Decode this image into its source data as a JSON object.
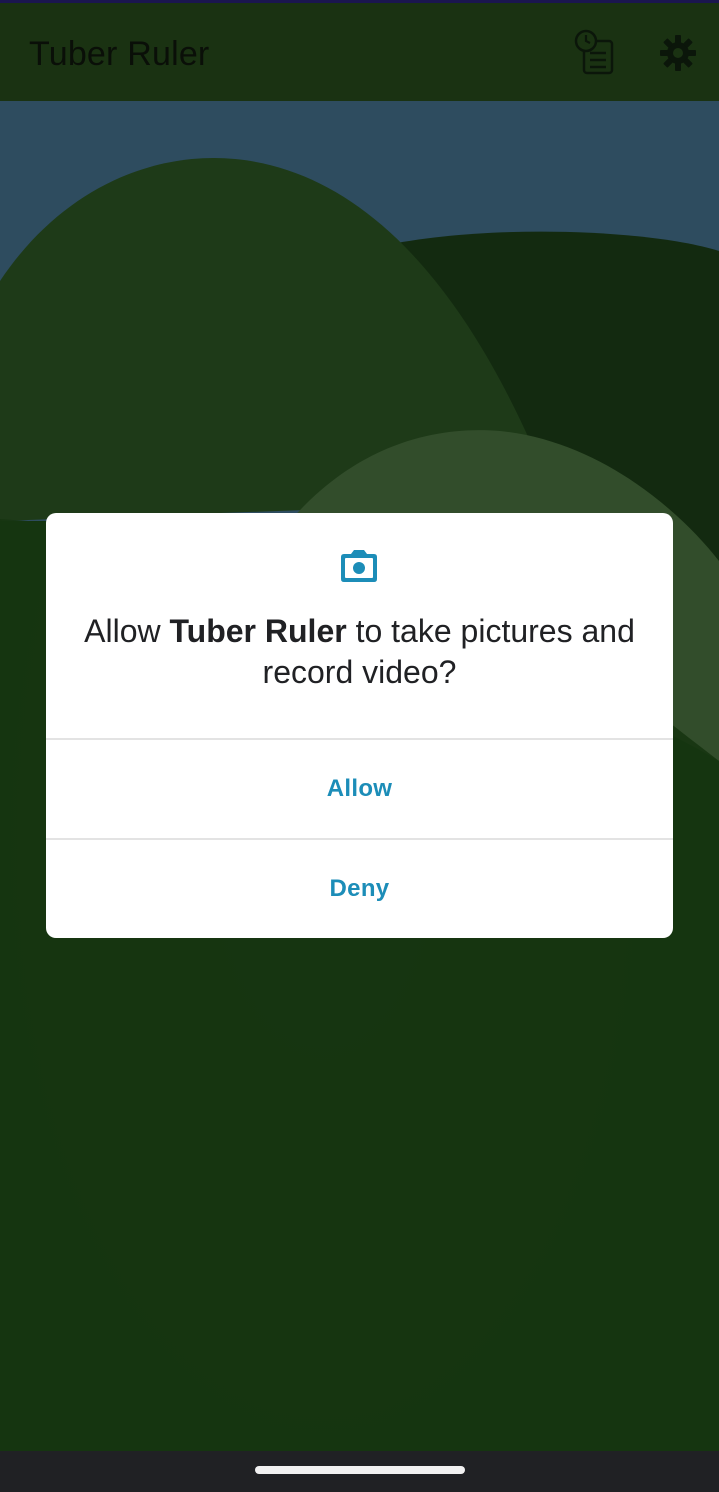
{
  "app_bar": {
    "title": "Tuber Ruler",
    "icons": [
      "history-list-icon",
      "settings-gear-icon"
    ]
  },
  "dialog": {
    "icon": "camera-icon",
    "message_prefix": "Allow ",
    "message_app": "Tuber Ruler",
    "message_suffix": " to take pictures and record video?",
    "allow_label": "Allow",
    "deny_label": "Deny"
  },
  "colors": {
    "accent": "#1c8db8",
    "app_bar": "#1a3212",
    "sky": "#2e4c5f",
    "grass": "#143310",
    "nav_bar": "#202124"
  }
}
